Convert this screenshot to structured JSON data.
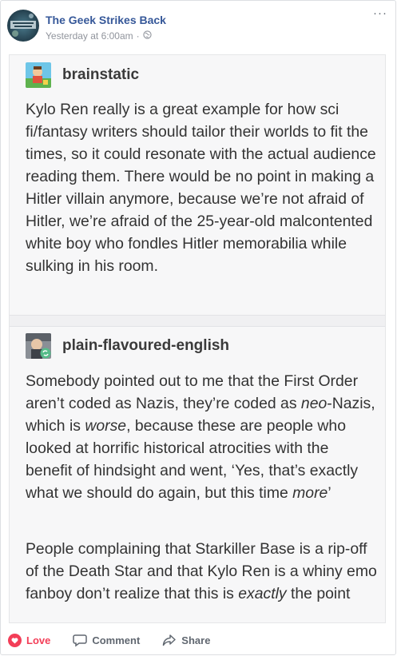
{
  "header": {
    "page_name": "The Geek Strikes Back",
    "timestamp": "Yesterday at 6:00am",
    "separator": "·",
    "privacy_icon": "globe-icon",
    "more_label": "···"
  },
  "embedded_posts": [
    {
      "username": "brainstatic",
      "text": "Kylo Ren really is a great example for how sci fi/fantasy writers should tailor their worlds to fit the times, so it could resonate with the actual audience reading them. There would be no point in making a Hitler villain anymore, because we’re not afraid of Hitler, we’re afraid of the 25-year-old malcontented white boy who fondles Hitler memorabilia while sulking in his room."
    },
    {
      "username": "plain-flavoured-english",
      "reblog_icon": "reblog-icon",
      "paragraph1": {
        "a": "Somebody pointed out to me that the First Order aren’t coded as Nazis, they’re coded as ",
        "b": "neo",
        "c": "-Nazis, which is ",
        "d": "worse",
        "e": ", because these are people who looked at horrific historical atrocities with the benefit of hindsight and went, ‘Yes, that’s exactly what we should do again, but this time ",
        "f": "more",
        "g": "’"
      },
      "paragraph2": {
        "a": "People complaining that Starkiller Base is a rip-off of the Death Star and that Kylo Ren is a whiny emo fanboy don’t realize that this is ",
        "b": "exactly",
        "c": " the point"
      }
    }
  ],
  "actions": {
    "love": "Love",
    "comment": "Comment",
    "share": "Share"
  },
  "colors": {
    "link_blue": "#365899",
    "love_red": "#f33e58",
    "muted": "#606770"
  }
}
